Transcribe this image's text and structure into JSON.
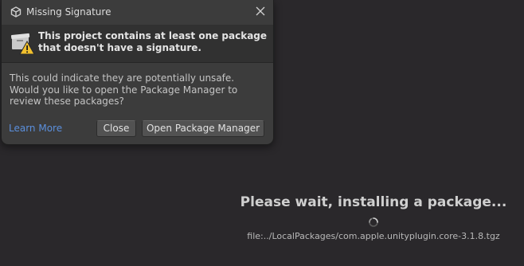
{
  "dialog": {
    "title": "Missing Signature",
    "header": "This project contains at least one package that doesn't have a signature.",
    "body": "This could indicate they are potentially unsafe. Would you like to open the Package Manager to review these packages?",
    "learn_more": "Learn More",
    "close_button": "Close",
    "open_button": "Open Package Manager",
    "icons": {
      "title": "unity-logo-icon",
      "header": "package-warning-icon",
      "close": "close-icon"
    }
  },
  "progress": {
    "status": "Please wait, installing a package...",
    "file": "file:../LocalPackages/com.apple.unityplugin.core-3.1.8.tgz",
    "icon": "loading-spinner-icon"
  },
  "colors": {
    "background": "#2a282b",
    "dialog": "#3c3c3c",
    "link": "#5b8fdc",
    "warning": "#f2c12e"
  }
}
